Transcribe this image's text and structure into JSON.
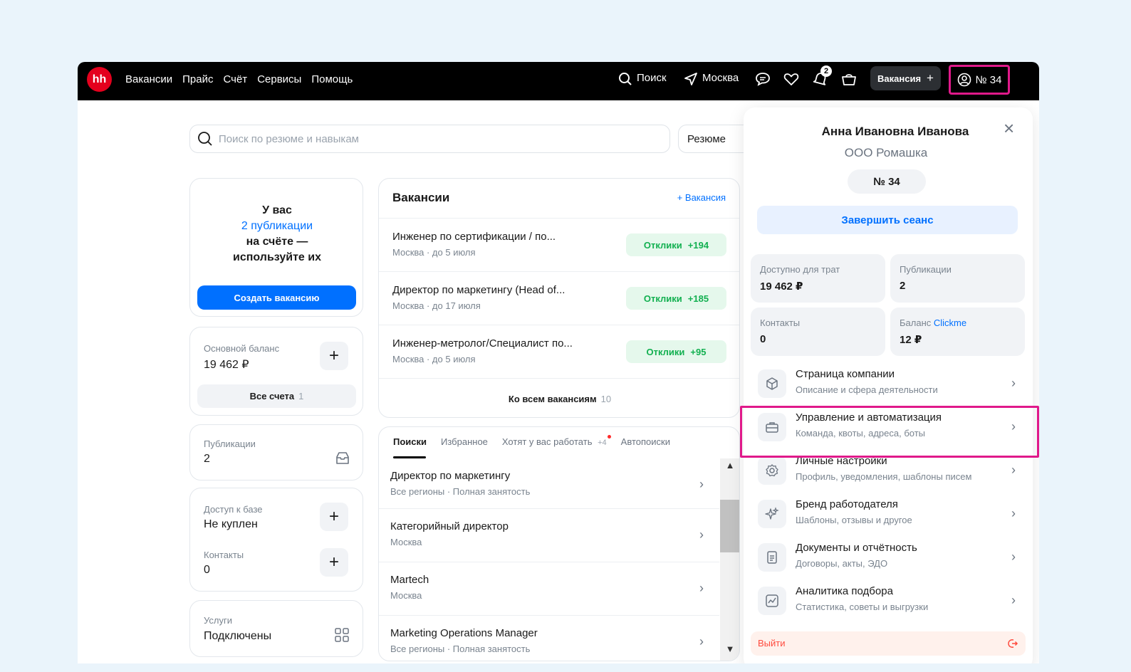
{
  "topbar": {
    "logo": "hh",
    "nav": [
      "Вакансии",
      "Прайс",
      "Счёт",
      "Сервисы",
      "Помощь"
    ],
    "search_label": "Поиск",
    "city": "Москва",
    "notifications_count": "2",
    "vacancy_button": "Вакансия",
    "account_label": "№ 34"
  },
  "search": {
    "placeholder": "Поиск по резюме и навыкам",
    "scope": "Резюме"
  },
  "promo": {
    "line1": "У вас",
    "line2": "2 публикации",
    "line3": "на счёте —",
    "line4": "используйте их",
    "button": "Создать вакансию"
  },
  "balance": {
    "label": "Основной баланс",
    "value": "19 462 ₽",
    "all_accounts": "Все счета",
    "all_accounts_count": "1"
  },
  "publications": {
    "label": "Публикации",
    "value": "2"
  },
  "db_access": {
    "label": "Доступ к базе",
    "value": "Не куплен",
    "contacts_label": "Контакты",
    "contacts_value": "0"
  },
  "services": {
    "label": "Услуги",
    "value": "Подключены"
  },
  "vacancies": {
    "title": "Вакансии",
    "add_link": "+ Вакансия",
    "items": [
      {
        "title": "Инженер по сертификации / по...",
        "sub": "Москва · до 5 июля",
        "resp_label": "Отклики",
        "resp_count": "+194"
      },
      {
        "title": "Директор по маркетингу (Head of...",
        "sub": "Москва · до 17 июля",
        "resp_label": "Отклики",
        "resp_count": "+185"
      },
      {
        "title": "Инженер-метролог/Специалист по...",
        "sub": "Москва · до 5 июля",
        "resp_label": "Отклики",
        "resp_count": "+95"
      }
    ],
    "all_link": "Ко всем вакансиям",
    "all_count": "10"
  },
  "searches": {
    "tabs": [
      "Поиски",
      "Избранное",
      "Хотят у вас работать",
      "Автопоиски"
    ],
    "tab_badge": "+4",
    "items": [
      {
        "title": "Директор по маркетингу",
        "sub": "Все регионы · Полная занятость"
      },
      {
        "title": "Категорийный директор",
        "sub": "Москва"
      },
      {
        "title": "Martech",
        "sub": "Москва"
      },
      {
        "title": "Marketing Operations Manager",
        "sub": "Все регионы · Полная занятость"
      }
    ]
  },
  "profile": {
    "name": "Анна Ивановна Иванова",
    "company": "ООО Ромашка",
    "number": "№ 34",
    "end_session": "Завершить сеанс",
    "stats": [
      {
        "label": "Доступно для трат",
        "value": "19 462 ₽"
      },
      {
        "label": "Публикации",
        "value": "2"
      },
      {
        "label": "Контакты",
        "value": "0"
      },
      {
        "label": "Баланс",
        "label_link": "Clickme",
        "value": "12 ₽"
      }
    ],
    "menu": [
      {
        "title": "Страница компании",
        "sub": "Описание и сфера деятельности",
        "icon": "building-icon"
      },
      {
        "title": "Управление и автоматизация",
        "sub": "Команда, квоты, адреса, боты",
        "icon": "briefcase-icon"
      },
      {
        "title": "Личные настройки",
        "sub": "Профиль, уведомления, шаблоны писем",
        "icon": "gear-icon"
      },
      {
        "title": "Бренд работодателя",
        "sub": "Шаблоны, отзывы и другое",
        "icon": "sparkle-icon"
      },
      {
        "title": "Документы и отчётность",
        "sub": "Договоры, акты, ЭДО",
        "icon": "document-icon"
      },
      {
        "title": "Аналитика подбора",
        "sub": "Статистика, советы и выгрузки",
        "icon": "analytics-icon"
      }
    ],
    "logout": "Выйти"
  },
  "colors": {
    "brand": "#e4001d",
    "accent": "#0070ff",
    "highlight": "#e0198a",
    "success": "#12b050",
    "logout": "#ff4a3d"
  }
}
